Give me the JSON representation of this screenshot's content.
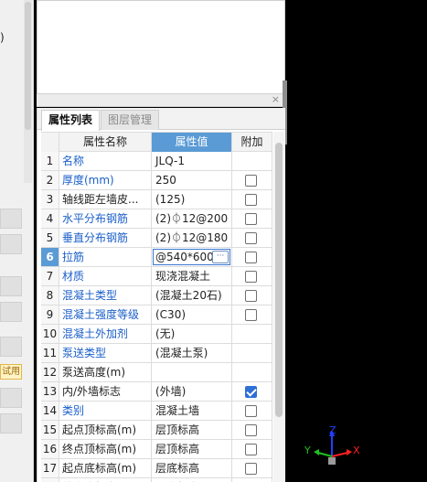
{
  "left_panel": {
    "frag1": ")",
    "trial_label": "试用"
  },
  "splitter": {
    "close": "×"
  },
  "tabs": [
    {
      "label": "属性列表",
      "active": true
    },
    {
      "label": "图层管理",
      "active": false
    }
  ],
  "table": {
    "headers": {
      "name": "属性名称",
      "value": "属性值",
      "add": "附加"
    },
    "rows": [
      {
        "num": "1",
        "name": "名称",
        "value": "JLQ-1",
        "blue": true,
        "check": null
      },
      {
        "num": "2",
        "name": "厚度(mm)",
        "value": "250",
        "blue": true,
        "check": false
      },
      {
        "num": "3",
        "name": "轴线距左墙皮...",
        "value": "(125)",
        "blue": false,
        "check": false
      },
      {
        "num": "4",
        "name": "水平分布钢筋",
        "value": "(2)⏀12@200",
        "blue": true,
        "check": false
      },
      {
        "num": "5",
        "name": "垂直分布钢筋",
        "value": "(2)⏀12@180",
        "blue": true,
        "check": false
      },
      {
        "num": "6",
        "name": "拉筋",
        "value": "@540*600",
        "blue": true,
        "check": false,
        "selected": true,
        "edit_button": "···"
      },
      {
        "num": "7",
        "name": "材质",
        "value": "现浇混凝土",
        "blue": true,
        "check": false
      },
      {
        "num": "8",
        "name": "混凝土类型",
        "value": "(混凝土20石)",
        "blue": true,
        "check": false
      },
      {
        "num": "9",
        "name": "混凝土强度等级",
        "value": "(C30)",
        "blue": true,
        "check": false
      },
      {
        "num": "10",
        "name": "混凝土外加剂",
        "value": "(无)",
        "blue": true,
        "check": null
      },
      {
        "num": "11",
        "name": "泵送类型",
        "value": "(混凝土泵)",
        "blue": true,
        "check": null
      },
      {
        "num": "12",
        "name": "泵送高度(m)",
        "value": "",
        "blue": false,
        "check": null
      },
      {
        "num": "13",
        "name": "内/外墙标志",
        "value": "(外墙)",
        "blue": false,
        "check": true
      },
      {
        "num": "14",
        "name": "类别",
        "value": "混凝土墙",
        "blue": true,
        "check": false
      },
      {
        "num": "15",
        "name": "起点顶标高(m)",
        "value": "层顶标高",
        "blue": false,
        "check": false
      },
      {
        "num": "16",
        "name": "终点顶标高(m)",
        "value": "层顶标高",
        "blue": false,
        "check": false
      },
      {
        "num": "17",
        "name": "起点底标高(m)",
        "value": "层底标高",
        "blue": false,
        "check": false
      },
      {
        "num": "18",
        "name": "终点底标高(m)",
        "value": "层底标高",
        "blue": false,
        "check": false
      }
    ]
  },
  "axis_gizmo": {
    "x": "X",
    "y": "Y",
    "z": "Z",
    "colors": {
      "x": "#ff2020",
      "y": "#20c020",
      "z": "#2040ff"
    }
  }
}
